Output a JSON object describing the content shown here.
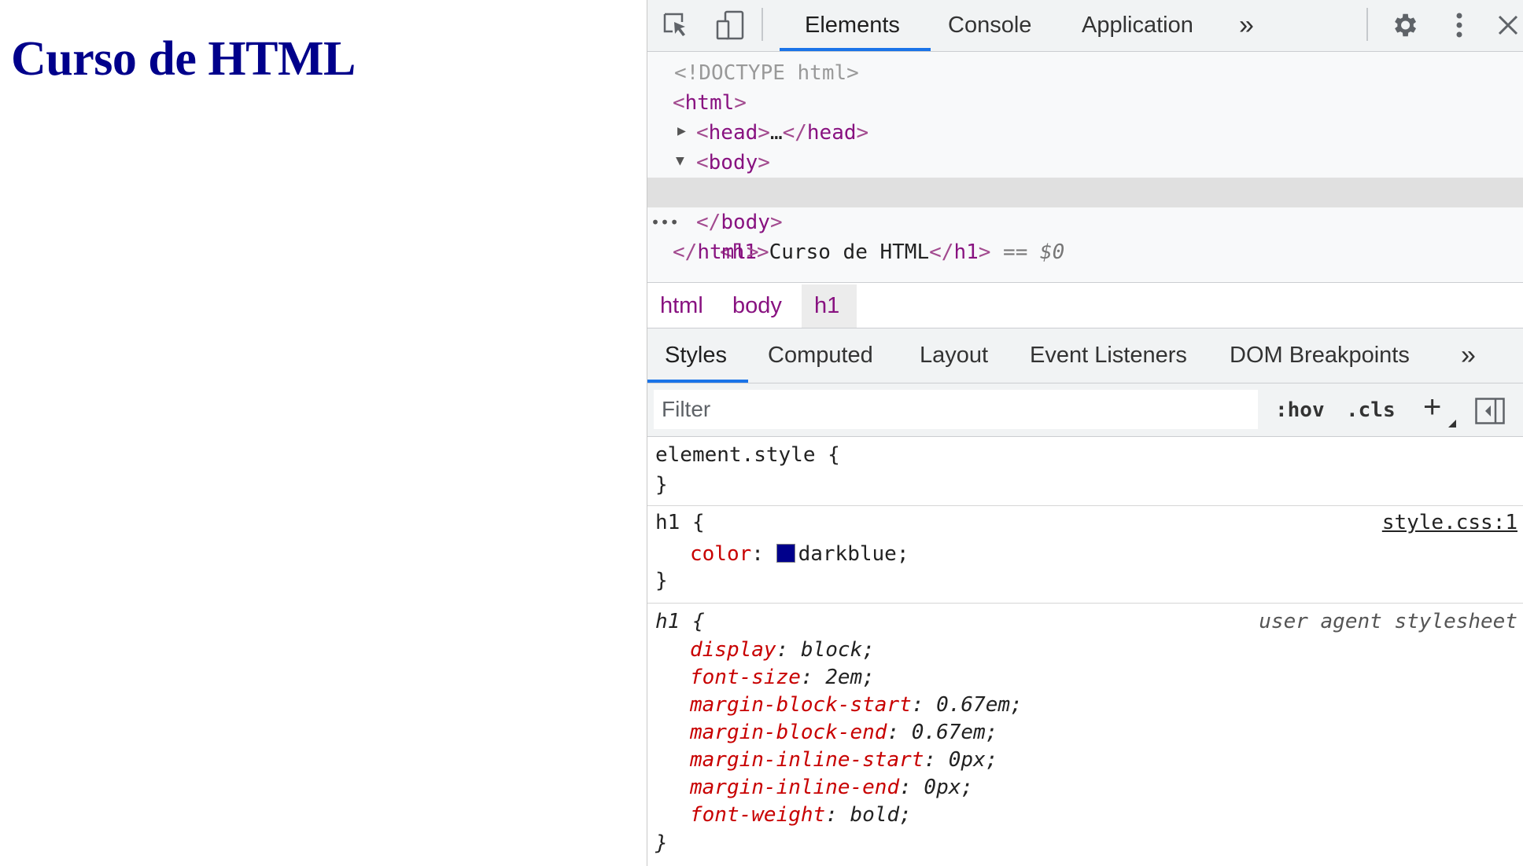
{
  "page": {
    "heading": "Curso de HTML"
  },
  "toolbar": {
    "tabs": [
      "Elements",
      "Console",
      "Application"
    ],
    "more": "»",
    "icons": [
      "inspect-icon",
      "device-toggle-icon",
      "gear-icon",
      "kebab-menu-icon",
      "close-icon"
    ]
  },
  "dom": {
    "doctype": "<!DOCTYPE html>",
    "html_open": "html",
    "head_tag": "head",
    "head_ellipsis": "…",
    "body_tag": "body",
    "h1_tag": "h1",
    "h1_text": "Curso de HTML",
    "eq": " == ",
    "var": "$0",
    "ellipsis_marker": "•••"
  },
  "breadcrumbs": [
    "html",
    "body",
    "h1"
  ],
  "subtabs": [
    "Styles",
    "Computed",
    "Layout",
    "Event Listeners",
    "DOM Breakpoints"
  ],
  "subtabs_more": "»",
  "filter": {
    "placeholder": "Filter",
    "hov": ":hov",
    "cls": ".cls",
    "plus": "+"
  },
  "rules": {
    "element_style": {
      "selector": "element.style {",
      "close": "}"
    },
    "h1_author": {
      "selector": "h1 {",
      "source": "style.css:1",
      "prop": "color",
      "value": "darkblue;",
      "swatch_color": "#00008b",
      "close": "}"
    },
    "h1_ua": {
      "selector": "h1 {",
      "source": "user agent stylesheet",
      "decls": [
        {
          "prop": "display",
          "value": "block;"
        },
        {
          "prop": "font-size",
          "value": "2em;"
        },
        {
          "prop": "margin-block-start",
          "value": "0.67em;"
        },
        {
          "prop": "margin-block-end",
          "value": "0.67em;"
        },
        {
          "prop": "margin-inline-start",
          "value": "0px;"
        },
        {
          "prop": "margin-inline-end",
          "value": "0px;"
        },
        {
          "prop": "font-weight",
          "value": "bold;"
        }
      ],
      "close": "}"
    }
  }
}
